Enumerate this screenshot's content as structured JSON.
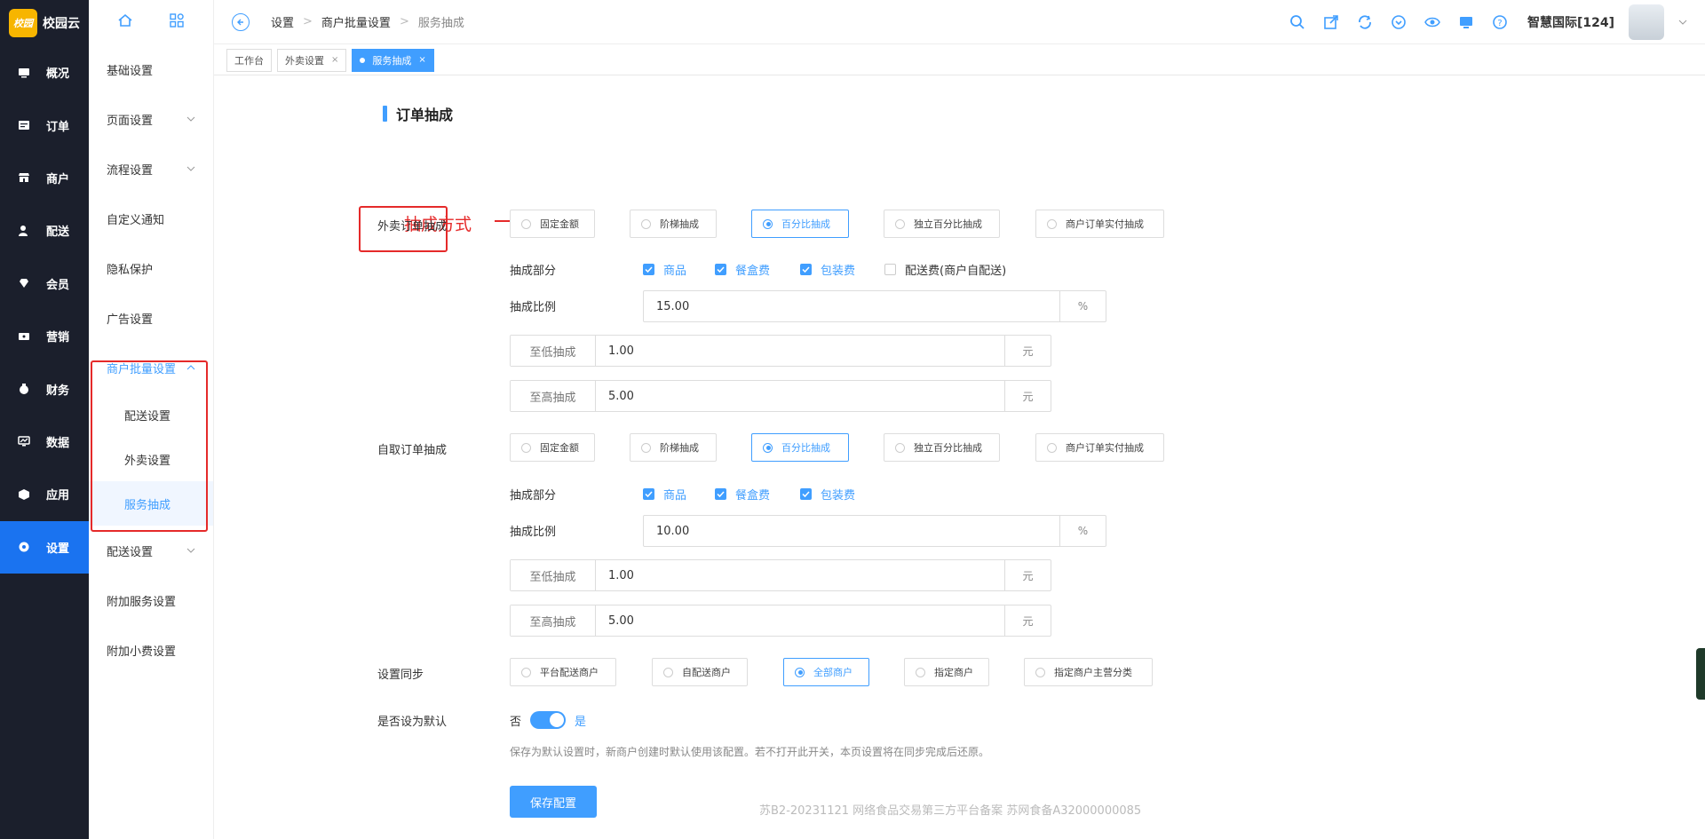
{
  "brand": {
    "logo_text": "校园",
    "name": "校园云"
  },
  "rail": [
    {
      "label": "概况",
      "icon": "overview-icon"
    },
    {
      "label": "订单",
      "icon": "order-icon"
    },
    {
      "label": "商户",
      "icon": "merchant-icon"
    },
    {
      "label": "配送",
      "icon": "delivery-icon"
    },
    {
      "label": "会员",
      "icon": "member-icon"
    },
    {
      "label": "营销",
      "icon": "marketing-icon"
    },
    {
      "label": "财务",
      "icon": "finance-icon"
    },
    {
      "label": "数据",
      "icon": "data-icon"
    },
    {
      "label": "应用",
      "icon": "app-icon"
    },
    {
      "label": "设置",
      "icon": "settings-icon",
      "active": true
    }
  ],
  "sidebar": {
    "items": [
      {
        "label": "基础设置"
      },
      {
        "label": "页面设置"
      },
      {
        "label": "流程设置"
      },
      {
        "label": "自定义通知"
      },
      {
        "label": "隐私保护"
      },
      {
        "label": "广告设置"
      },
      {
        "label": "商户批量设置"
      },
      {
        "label": "配送设置"
      },
      {
        "label": "附加服务设置"
      },
      {
        "label": "附加小费设置"
      }
    ],
    "subitems": [
      {
        "label": "配送设置"
      },
      {
        "label": "外卖设置"
      },
      {
        "label": "服务抽成",
        "active": true
      }
    ]
  },
  "header": {
    "breadcrumb": [
      "设置",
      "商户批量设置",
      "服务抽成"
    ],
    "user": "智慧国际[124]"
  },
  "tabs": [
    {
      "label": "工作台"
    },
    {
      "label": "外卖设置"
    },
    {
      "label": "服务抽成",
      "active": true
    }
  ],
  "annotation": {
    "text": "抽成方式",
    "color": "#e52a2a"
  },
  "form": {
    "section_title": "订单抽成",
    "mode_options": [
      "固定金额",
      "阶梯抽成",
      "百分比抽成",
      "独立百分比抽成",
      "商户订单实付抽成"
    ],
    "takeout": {
      "label": "外卖订单抽成",
      "selected": "百分比抽成",
      "part_label": "抽成部分",
      "parts": [
        {
          "label": "商品",
          "checked": true
        },
        {
          "label": "餐盒费",
          "checked": true
        },
        {
          "label": "包装费",
          "checked": true
        },
        {
          "label": "配送费(商户自配送)",
          "checked": false
        }
      ],
      "ratio_label": "抽成比例",
      "ratio": "15.00",
      "ratio_unit": "%",
      "min_label": "至低抽成",
      "min": "1.00",
      "max_label": "至高抽成",
      "max": "5.00",
      "unit": "元"
    },
    "pickup": {
      "label": "自取订单抽成",
      "selected": "百分比抽成",
      "part_label": "抽成部分",
      "parts": [
        {
          "label": "商品",
          "checked": true
        },
        {
          "label": "餐盒费",
          "checked": true
        },
        {
          "label": "包装费",
          "checked": true
        }
      ],
      "ratio_label": "抽成比例",
      "ratio": "10.00",
      "ratio_unit": "%",
      "min_label": "至低抽成",
      "min": "1.00",
      "max_label": "至高抽成",
      "max": "5.00",
      "unit": "元"
    },
    "sync": {
      "label": "设置同步",
      "options": [
        "平台配送商户",
        "自配送商户",
        "全部商户",
        "指定商户",
        "指定商户主营分类"
      ],
      "selected": "全部商户"
    },
    "default": {
      "label": "是否设为默认",
      "off_label": "否",
      "on_label": "是",
      "value": true,
      "hint": "保存为默认设置时，新商户创建时默认使用该配置。若不打开此开关，本页设置将在同步完成后还原。"
    },
    "save_label": "保存配置"
  },
  "footer": "苏B2-20231121  网络食品交易第三方平台备案 苏网食备A32000000085",
  "colors": {
    "primary": "#409eff",
    "rail_bg": "#1b1f2c",
    "rail_active": "#1a73f0",
    "annotation": "#e52a2a"
  }
}
